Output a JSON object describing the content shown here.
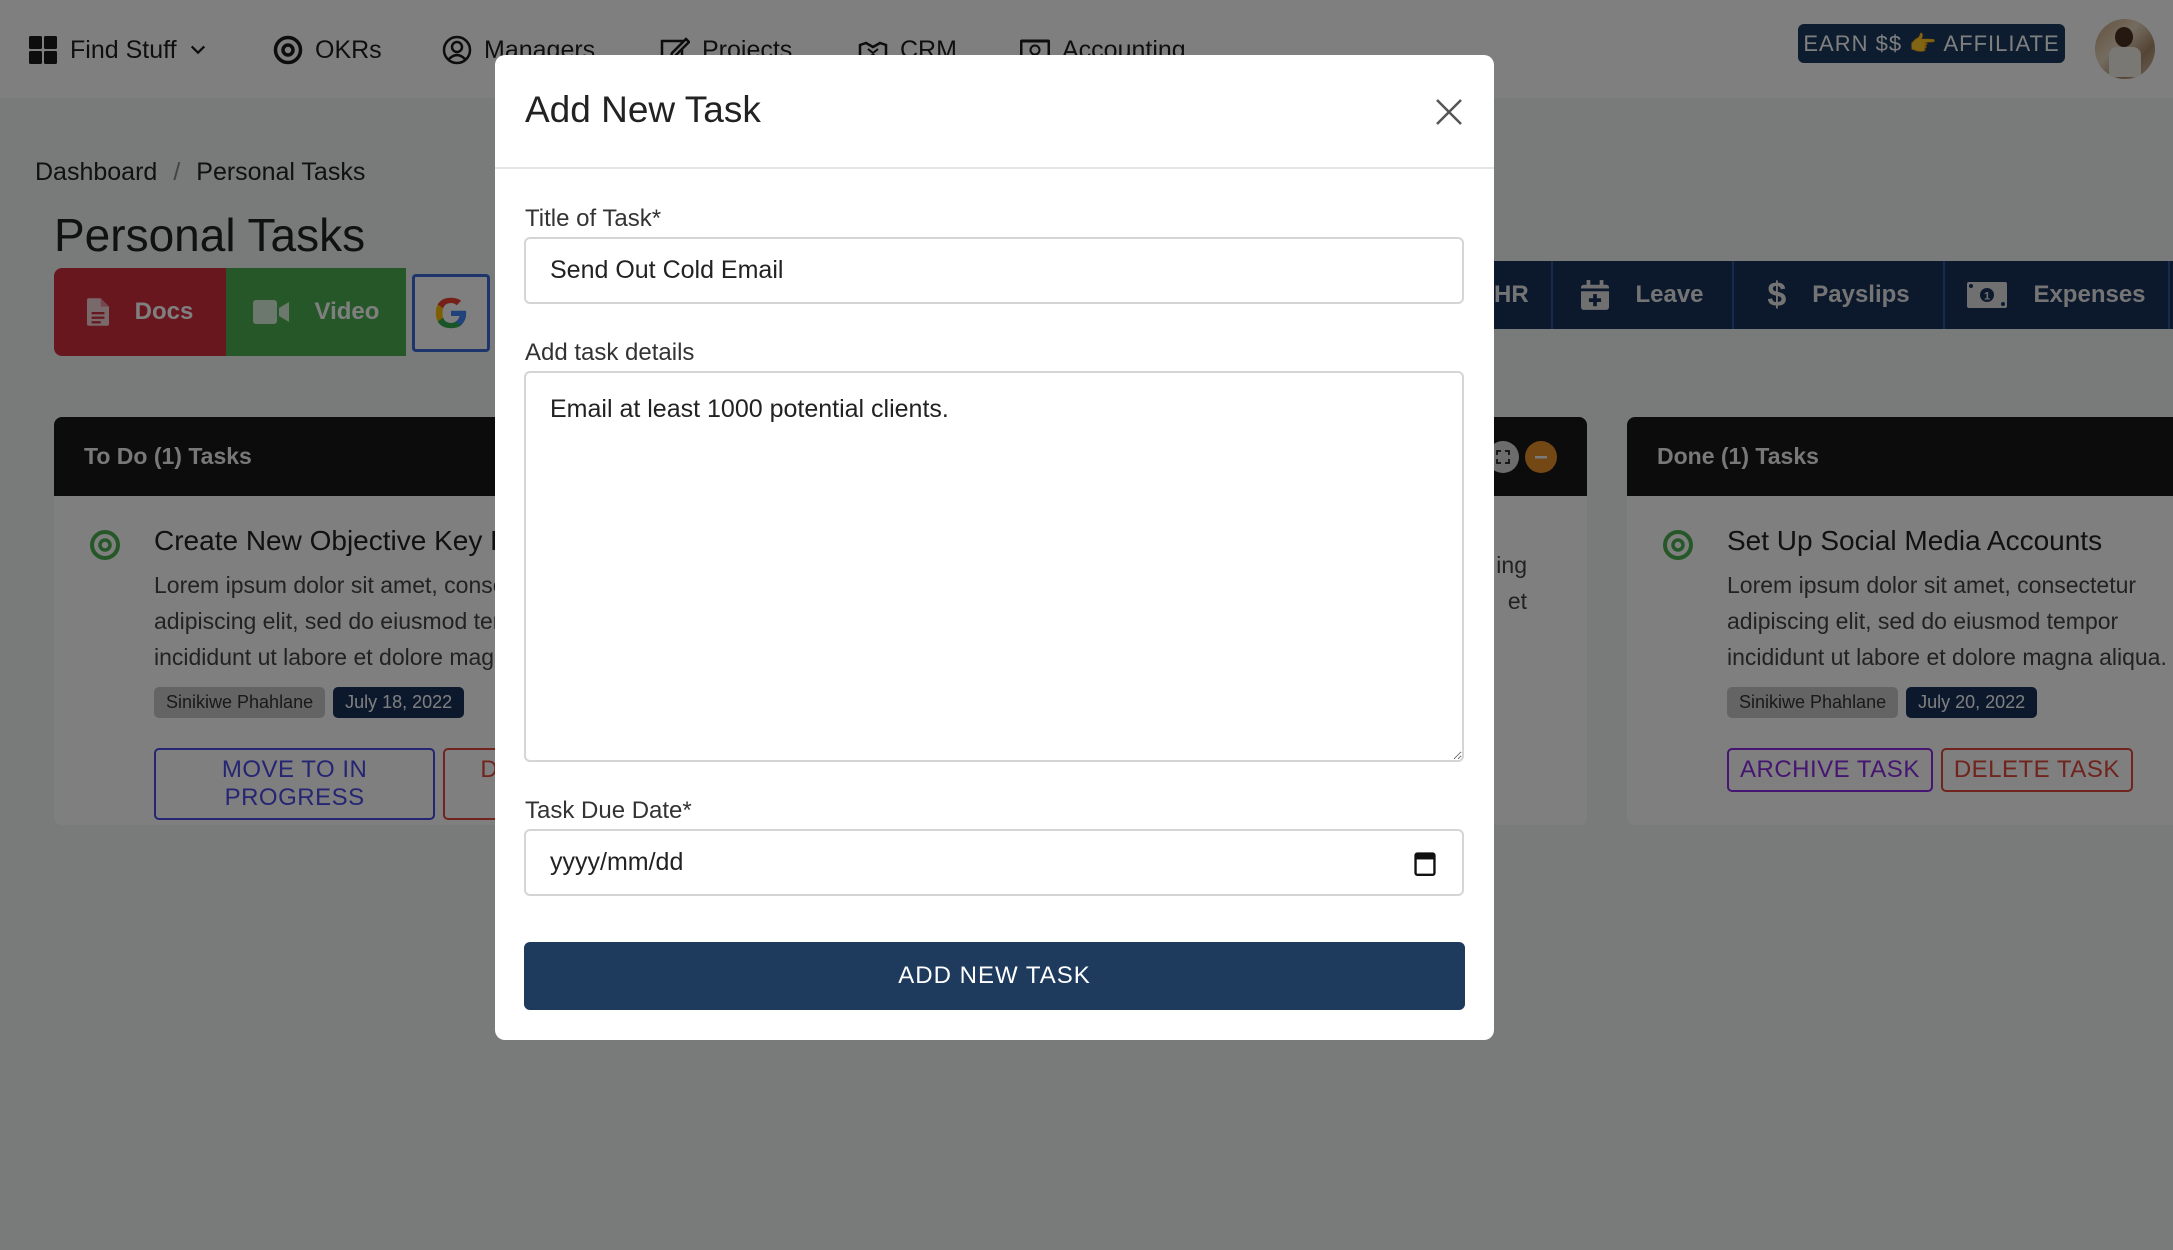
{
  "nav": {
    "find_stuff": "Find Stuff",
    "okrs": "OKRs",
    "managers": "Managers",
    "projects": "Projects",
    "crm": "CRM",
    "accounting": "Accounting",
    "affiliate": "EARN $$ 👉 AFFILIATE"
  },
  "breadcrumb": {
    "home": "Dashboard",
    "separator": "/",
    "current": "Personal Tasks"
  },
  "page_title": "Personal Tasks",
  "toolbar": {
    "docs": "Docs",
    "video": "Video",
    "google": "G"
  },
  "hr_bar": {
    "hr": "HR",
    "leave": "Leave",
    "payslips": "Payslips",
    "expenses": "Expenses"
  },
  "columns": [
    {
      "header": "To Do (1) Tasks",
      "task": {
        "title": "Create New Objective Key Results",
        "desc": "Lorem ipsum dolor sit amet, consectetur adipiscing elit, sed do eiusmod tempor incididunt ut labore et dolore magna aliqua.",
        "user": "Sinikiwe Phahlane",
        "date": "July 18, 2022",
        "actions": [
          "MOVE TO IN PROGRESS",
          "DELETE TASK"
        ]
      }
    },
    {
      "header": "Done (1) Tasks",
      "task": {
        "title": "Set Up Social Media Accounts",
        "desc": "Lorem ipsum dolor sit amet, consectetur adipiscing elit, sed do eiusmod tempor incididunt ut labore et dolore magna aliqua.",
        "user": "Sinikiwe Phahlane",
        "date": "July 20, 2022",
        "actions": [
          "ARCHIVE TASK",
          "DELETE TASK"
        ]
      }
    }
  ],
  "middle_column_partial": {
    "line1_tail": "ing",
    "line2_tail": "et"
  },
  "modal": {
    "title": "Add New Task",
    "title_label": "Title of Task*",
    "title_value": "Send Out Cold Email",
    "details_label": "Add task details",
    "details_value": "Email at least 1000 potential clients.",
    "due_label": "Task Due Date*",
    "due_placeholder": "yyyy/mm/dd",
    "submit": "ADD NEW TASK"
  },
  "colors": {
    "brand_navy": "#1e3b5e",
    "docs_red": "#d32f3f",
    "video_green": "#4caf50",
    "move_blue": "#4a4ae8",
    "delete_red": "#e0483a",
    "archive_purple": "#8a2be2"
  }
}
